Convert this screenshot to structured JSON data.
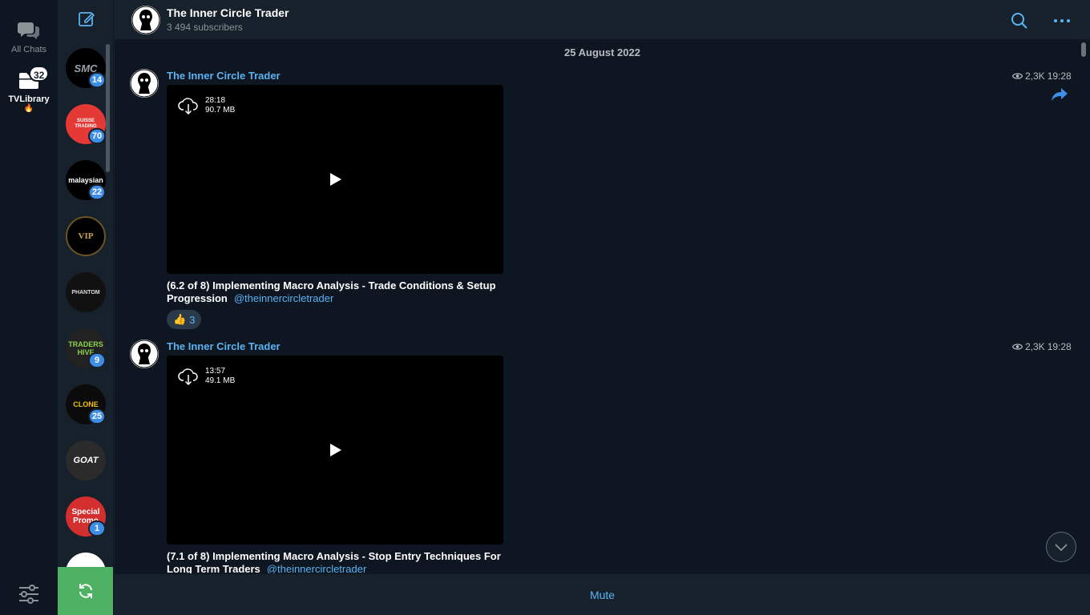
{
  "folders": {
    "all_chats": "All Chats",
    "tv_library": "TVLibrary",
    "tv_library_emoji": "🔥",
    "tv_library_badge": "32"
  },
  "chats": [
    {
      "avatar_text": "SMC",
      "badge": "14",
      "bg": "#000000",
      "fg": "#9aa0a6"
    },
    {
      "avatar_text": "SUISSE TRADING",
      "badge": "70",
      "bg": "#e53935",
      "fg": "#ffffff"
    },
    {
      "avatar_text": "malaysian",
      "badge": "22",
      "bg": "#000000",
      "fg": "#ffffff"
    },
    {
      "avatar_text": "VIP",
      "badge": "",
      "bg": "#000000",
      "fg": "#c9a54a"
    },
    {
      "avatar_text": "PHANTOM",
      "badge": "",
      "bg": "#111111",
      "fg": "#dddddd"
    },
    {
      "avatar_text": "TRADERS HIVE",
      "badge": "9",
      "bg": "#222222",
      "fg": "#8bd14a"
    },
    {
      "avatar_text": "CLONE",
      "badge": "25",
      "bg": "#0b0b0b",
      "fg": "#f2c300"
    },
    {
      "avatar_text": "GOAT",
      "badge": "",
      "bg": "#2b2b2b",
      "fg": "#ffffff"
    },
    {
      "avatar_text": "Special Promo",
      "badge": "1",
      "bg": "#d32f2f",
      "fg": "#ffffff"
    }
  ],
  "header": {
    "title": "The Inner Circle Trader",
    "subscribers": "3 494 subscribers"
  },
  "date_separator": "25 August 2022",
  "messages": [
    {
      "author": "The Inner Circle Trader",
      "views": "2,3K",
      "time": "19:28",
      "video_duration": "28:18",
      "video_size": "90.7 MB",
      "caption": "(6.2 of 8) Implementing Macro Analysis - Trade Conditions & Setup Progression",
      "handle": "@theinnercircletrader",
      "reaction_emoji": "👍",
      "reaction_count": "3"
    },
    {
      "author": "The Inner Circle Trader",
      "views": "2,3K",
      "time": "19:28",
      "video_duration": "13:57",
      "video_size": "49.1 MB",
      "caption": "(7.1 of 8) Implementing Macro Analysis - Stop Entry Techniques For Long Term Traders",
      "handle": "@theinnercircletrader"
    }
  ],
  "bottom": {
    "mute_label": "Mute"
  },
  "colors": {
    "accent": "#5ab3f2",
    "badge": "#3e8ee8",
    "refresh": "#4eb163"
  }
}
